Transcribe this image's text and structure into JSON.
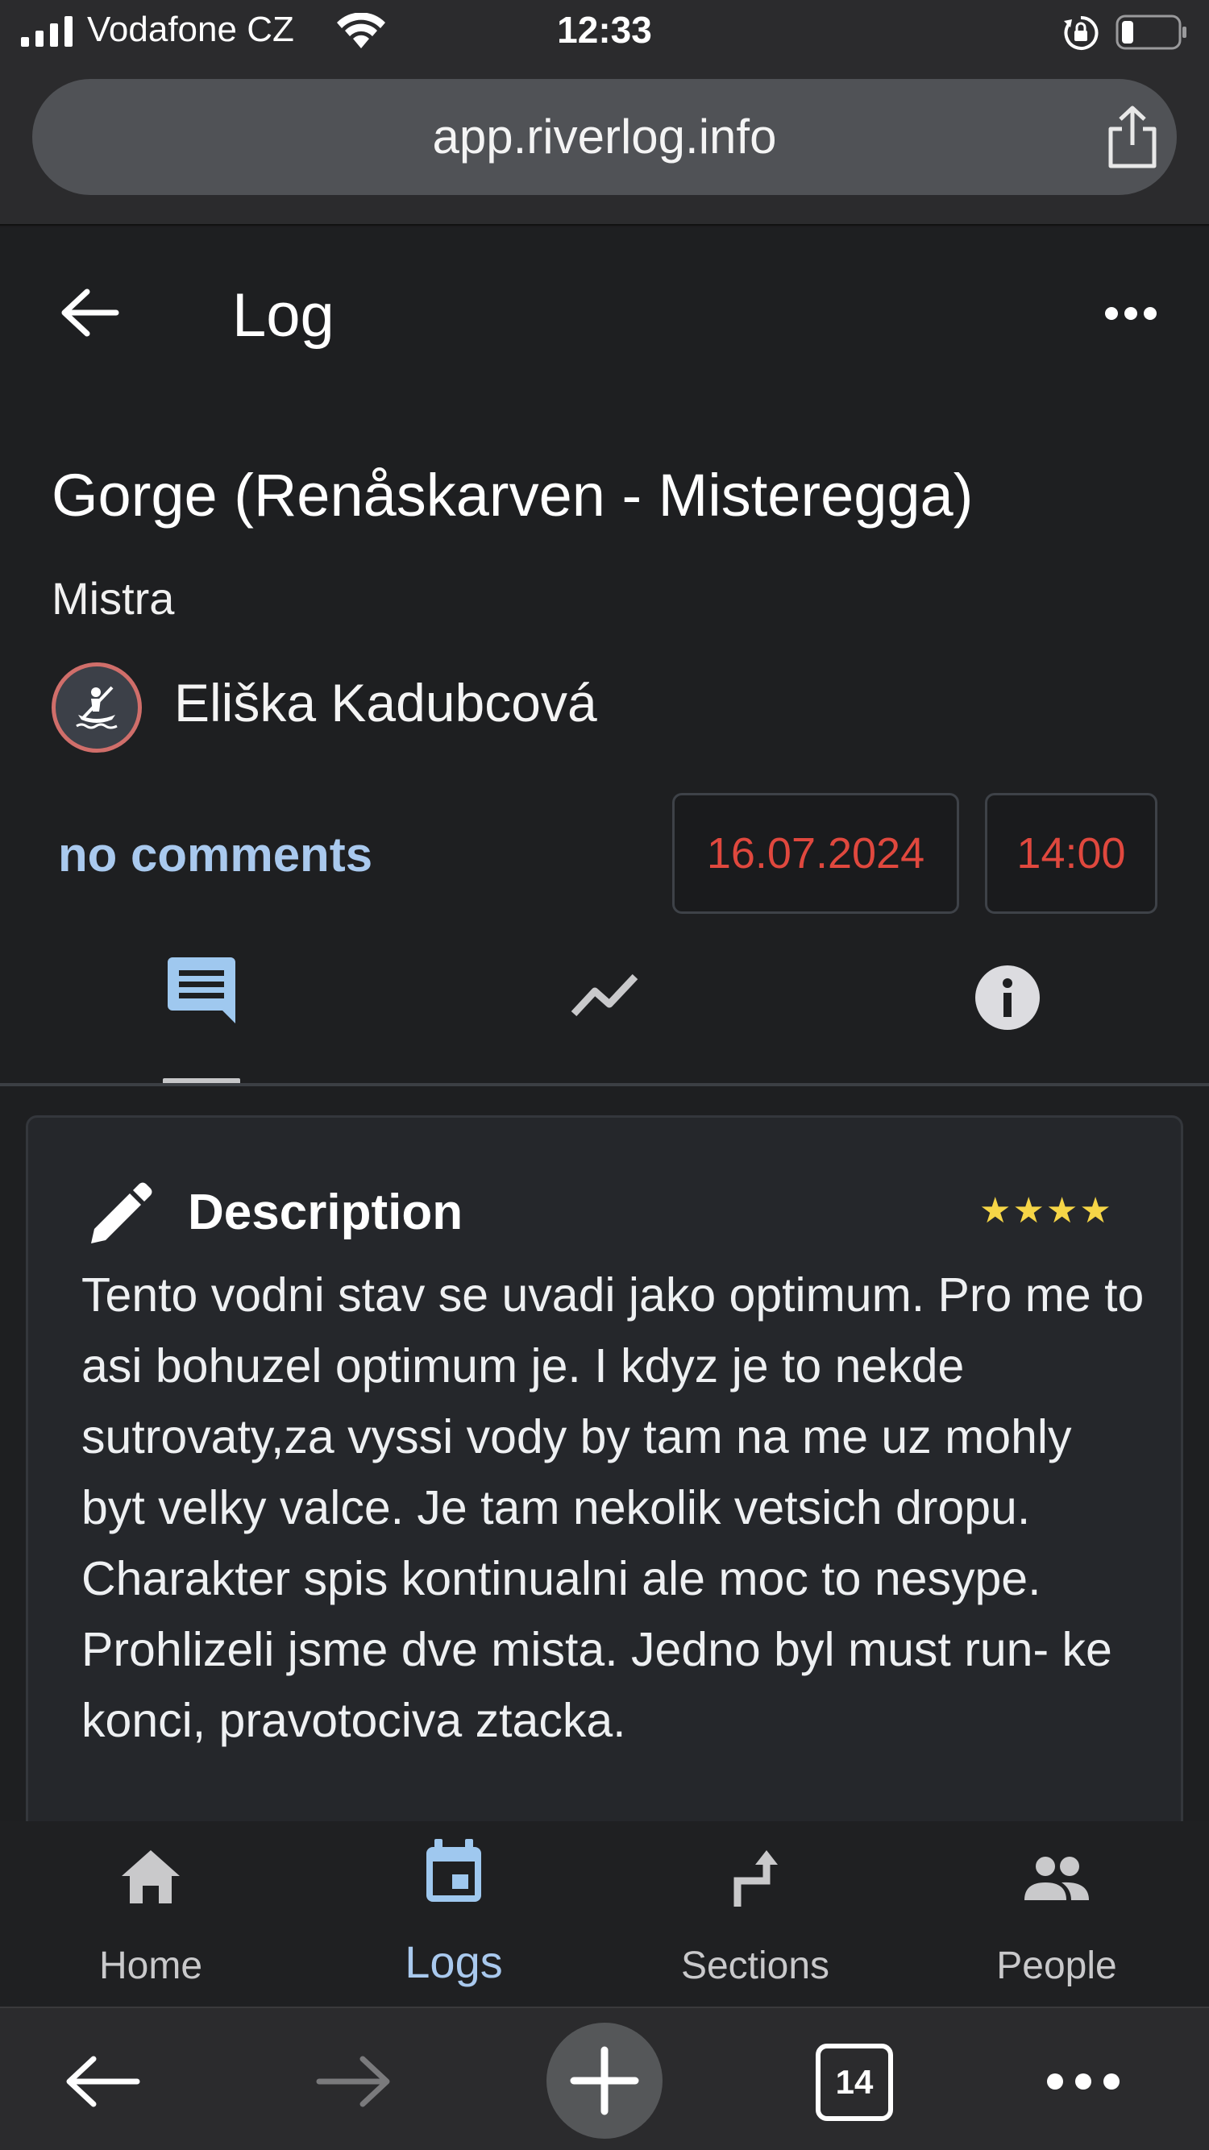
{
  "status_bar": {
    "carrier": "Vodafone CZ",
    "time": "12:33"
  },
  "browser": {
    "url": "app.riverlog.info",
    "tab_count": "14"
  },
  "header": {
    "title": "Log"
  },
  "log": {
    "title": "Gorge (Renåskarven - Misteregga)",
    "river": "Mistra",
    "author": "Eliška Kadubcová",
    "comments_link": "no comments",
    "date": "16.07.2024",
    "time": "14:00"
  },
  "tabs": [
    {
      "name": "description",
      "icon": "comment-icon",
      "active": true
    },
    {
      "name": "chart",
      "icon": "trending-icon",
      "active": false
    },
    {
      "name": "info",
      "icon": "info-icon",
      "active": false
    }
  ],
  "description": {
    "title": "Description",
    "stars": "★★★★",
    "rating": 4,
    "text": "Tento vodni stav se uvadi jako optimum. Pro me to asi bohuzel optimum je. I kdyz je to nekde sutrovaty,za vyssi vody by tam na me uz mohly byt velky valce. Je tam nekolik vetsich dropu. Charakter spis kontinualni ale moc to nesype. Prohlizeli jsme dve mista. Jedno byl must run- ke konci, pravotociva ztacka."
  },
  "bottom_nav": {
    "home": "Home",
    "logs": "Logs",
    "sections": "Sections",
    "people": "People"
  },
  "colors": {
    "accent": "#a9c9ee",
    "date_red": "#e0483e",
    "star_yellow": "#f5d547",
    "avatar_ring": "#d06e6a"
  }
}
